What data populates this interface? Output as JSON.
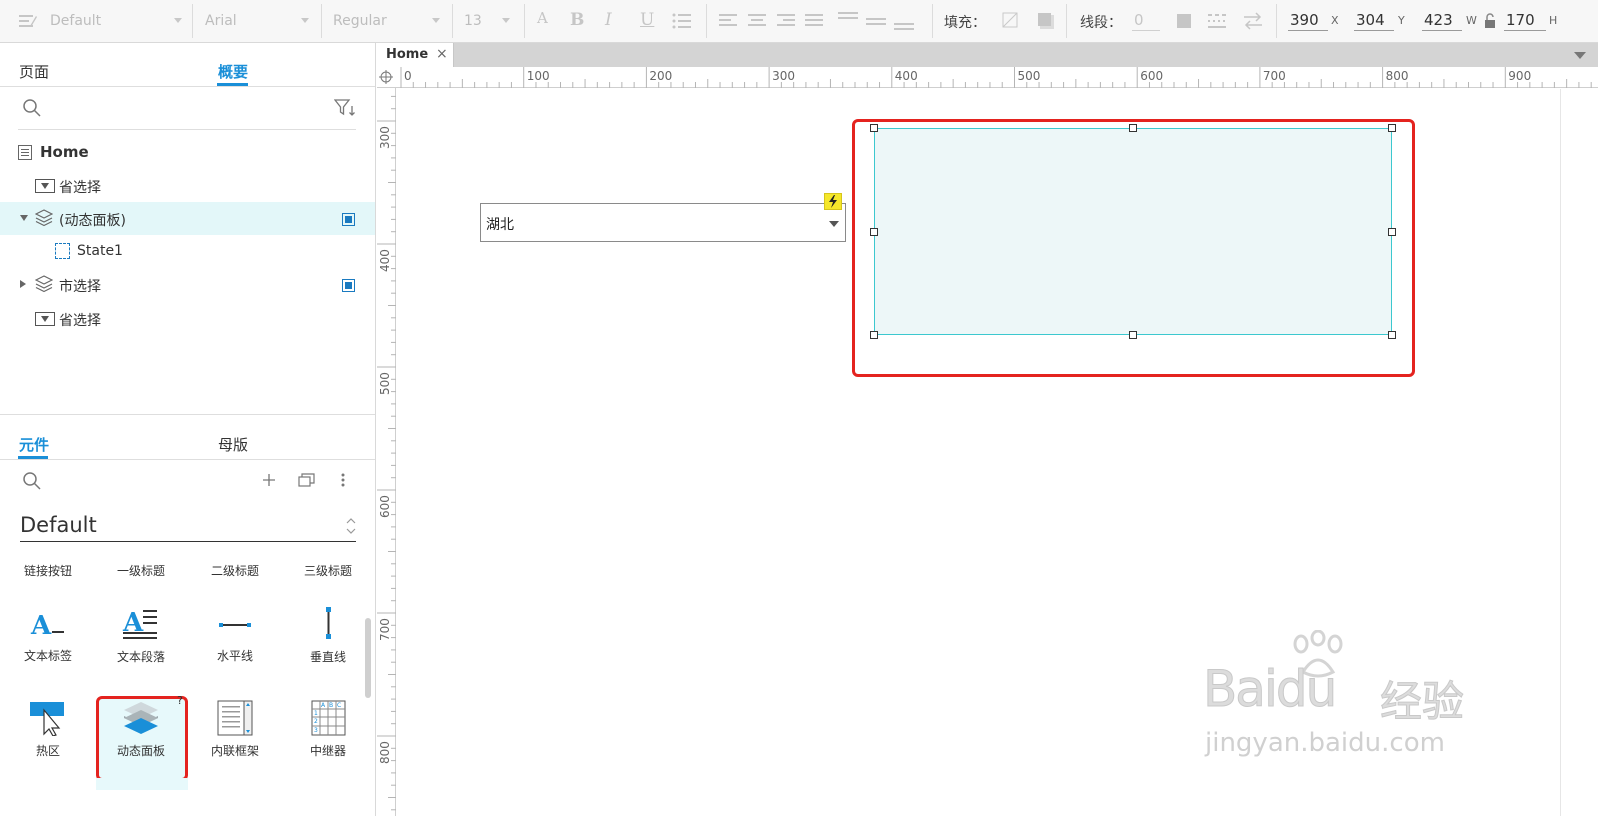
{
  "toolbar": {
    "style_value": "Default",
    "font_family_value": "Arial",
    "font_weight_value": "Regular",
    "font_size_value": "13",
    "fill_label": "填充：",
    "line_label": "线段：",
    "line_width_value": "0",
    "x_value": "390",
    "x_label": "X",
    "y_value": "304",
    "y_label": "Y",
    "w_value": "423",
    "w_label": "W",
    "h_value": "170",
    "h_label": "H"
  },
  "pages_panel": {
    "tabs": [
      "页面",
      "概要"
    ],
    "active_tab": "概要",
    "tree": [
      {
        "label": "Home"
      },
      {
        "label": "省选择"
      },
      {
        "label": "(动态面板)"
      },
      {
        "label": "State1"
      },
      {
        "label": "市选择"
      },
      {
        "label": "省选择"
      }
    ]
  },
  "library_panel": {
    "tabs": [
      "元件",
      "母版"
    ],
    "active_tab": "元件",
    "library_name": "Default",
    "text_row": [
      "链接按钮",
      "一级标题",
      "二级标题",
      "三级标题"
    ],
    "items_row1": [
      "文本标签",
      "文本段落",
      "水平线",
      "垂直线"
    ],
    "items_row2": [
      "热区",
      "动态面板",
      "内联框架",
      "中继器"
    ]
  },
  "canvas": {
    "tab_label": "Home",
    "ruler_h": [
      "0",
      "100",
      "200",
      "300",
      "400",
      "500",
      "600",
      "700",
      "800",
      "900"
    ],
    "ruler_v": [
      "300",
      "400",
      "500",
      "600",
      "700",
      "800"
    ],
    "dropdown_value": "湖北"
  },
  "watermark": {
    "brand": "Baidu",
    "brand_cn": "经验",
    "url": "jingyan.baidu.com"
  },
  "colors": {
    "accent": "#1a8fd8",
    "highlight_red": "#e4231f",
    "panel_fill": "#edf7f8",
    "panel_border": "#3cc8cf",
    "selected_row": "#e3f7f9"
  }
}
